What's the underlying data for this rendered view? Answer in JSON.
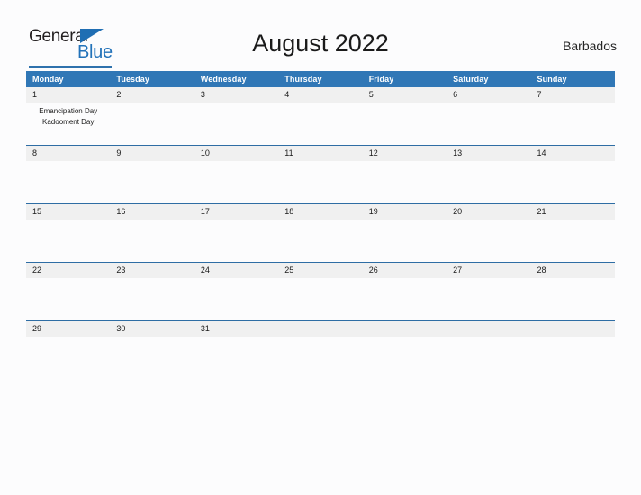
{
  "brand": {
    "name_part1": "General",
    "name_part2": "Blue",
    "logo_icon": "blue-triangle-flag-icon",
    "accent_color": "#2272b9",
    "rule_color": "#2e72ad"
  },
  "header": {
    "title": "August 2022",
    "region": "Barbados"
  },
  "calendar": {
    "month": "August",
    "year": "2022",
    "header_bg": "#3077b6",
    "header_text_color": "#ffffff",
    "row_divider_color": "#2e6da4",
    "daynum_band_color": "#f0f0f0",
    "weekday_headers": [
      "Monday",
      "Tuesday",
      "Wednesday",
      "Thursday",
      "Friday",
      "Saturday",
      "Sunday"
    ],
    "weeks": [
      [
        {
          "day": "1",
          "events": [
            "Emancipation Day",
            "Kadooment Day"
          ]
        },
        {
          "day": "2",
          "events": []
        },
        {
          "day": "3",
          "events": []
        },
        {
          "day": "4",
          "events": []
        },
        {
          "day": "5",
          "events": []
        },
        {
          "day": "6",
          "events": []
        },
        {
          "day": "7",
          "events": []
        }
      ],
      [
        {
          "day": "8",
          "events": []
        },
        {
          "day": "9",
          "events": []
        },
        {
          "day": "10",
          "events": []
        },
        {
          "day": "11",
          "events": []
        },
        {
          "day": "12",
          "events": []
        },
        {
          "day": "13",
          "events": []
        },
        {
          "day": "14",
          "events": []
        }
      ],
      [
        {
          "day": "15",
          "events": []
        },
        {
          "day": "16",
          "events": []
        },
        {
          "day": "17",
          "events": []
        },
        {
          "day": "18",
          "events": []
        },
        {
          "day": "19",
          "events": []
        },
        {
          "day": "20",
          "events": []
        },
        {
          "day": "21",
          "events": []
        }
      ],
      [
        {
          "day": "22",
          "events": []
        },
        {
          "day": "23",
          "events": []
        },
        {
          "day": "24",
          "events": []
        },
        {
          "day": "25",
          "events": []
        },
        {
          "day": "26",
          "events": []
        },
        {
          "day": "27",
          "events": []
        },
        {
          "day": "28",
          "events": []
        }
      ],
      [
        {
          "day": "29",
          "events": []
        },
        {
          "day": "30",
          "events": []
        },
        {
          "day": "31",
          "events": []
        },
        {
          "day": "",
          "events": []
        },
        {
          "day": "",
          "events": []
        },
        {
          "day": "",
          "events": []
        },
        {
          "day": "",
          "events": []
        }
      ]
    ]
  }
}
